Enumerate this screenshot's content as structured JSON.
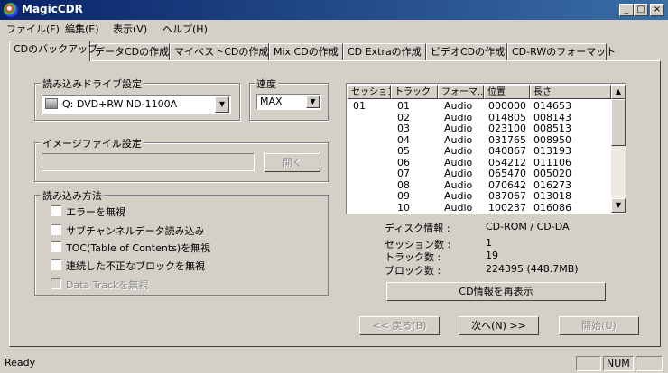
{
  "window": {
    "title": "MagicCDR",
    "min": "_",
    "max": "□",
    "close": "×"
  },
  "menu": [
    "ファイル(F)",
    "編集(E)",
    "表示(V)",
    "ヘルプ(H)"
  ],
  "tabs": [
    "CDのバックアップ",
    "データCDの作成",
    "マイベストCDの作成",
    "Mix CDの作成",
    "CD Extraの作成",
    "ビデオCDの作成",
    "CD-RWのフォーマット"
  ],
  "drive_group": {
    "label": "読み込みドライブ設定",
    "drive": "Q: DVD+RW ND-1100A"
  },
  "speed_group": {
    "label": "速度",
    "value": "MAX"
  },
  "image_group": {
    "label": "イメージファイル設定",
    "path": "",
    "open_button": "開く"
  },
  "read_group": {
    "label": "読み込み方法",
    "options": [
      {
        "label": "エラーを無視",
        "checked": false,
        "enabled": true
      },
      {
        "label": "サブチャンネルデータ読み込み",
        "checked": false,
        "enabled": true
      },
      {
        "label": "TOC(Table of Contents)を無視",
        "checked": false,
        "enabled": true
      },
      {
        "label": "連続した不正なブロックを無視",
        "checked": false,
        "enabled": true
      },
      {
        "label": "Data Trackを無視",
        "checked": false,
        "enabled": false
      }
    ]
  },
  "tracklist": {
    "columns": [
      "セッション",
      "トラック",
      "フォーマ...",
      "位置",
      "長さ"
    ],
    "rows": [
      {
        "session": "01",
        "track": "01",
        "format": "Audio",
        "position": "000000",
        "length": "014653"
      },
      {
        "session": "",
        "track": "02",
        "format": "Audio",
        "position": "014805",
        "length": "008143"
      },
      {
        "session": "",
        "track": "03",
        "format": "Audio",
        "position": "023100",
        "length": "008513"
      },
      {
        "session": "",
        "track": "04",
        "format": "Audio",
        "position": "031765",
        "length": "008950"
      },
      {
        "session": "",
        "track": "05",
        "format": "Audio",
        "position": "040867",
        "length": "013193"
      },
      {
        "session": "",
        "track": "06",
        "format": "Audio",
        "position": "054212",
        "length": "011106"
      },
      {
        "session": "",
        "track": "07",
        "format": "Audio",
        "position": "065470",
        "length": "005020"
      },
      {
        "session": "",
        "track": "08",
        "format": "Audio",
        "position": "070642",
        "length": "016273"
      },
      {
        "session": "",
        "track": "09",
        "format": "Audio",
        "position": "087067",
        "length": "013018"
      },
      {
        "session": "",
        "track": "10",
        "format": "Audio",
        "position": "100237",
        "length": "016086"
      }
    ]
  },
  "disc_info": {
    "items": [
      {
        "label": "ディスク情報 :",
        "value": "CD-ROM / CD-DA"
      },
      {
        "label": "セッション数 :",
        "value": "1"
      },
      {
        "label": "トラック数 :",
        "value": "19"
      },
      {
        "label": "ブロック数 :",
        "value": "224395  (448.7MB)"
      }
    ],
    "refresh_button": "CD情報を再表示"
  },
  "nav": {
    "back": "<< 戻る(B)",
    "next": "次へ(N) >>",
    "start": "開始(U)"
  },
  "status": {
    "text": "Ready",
    "num": "NUM"
  }
}
